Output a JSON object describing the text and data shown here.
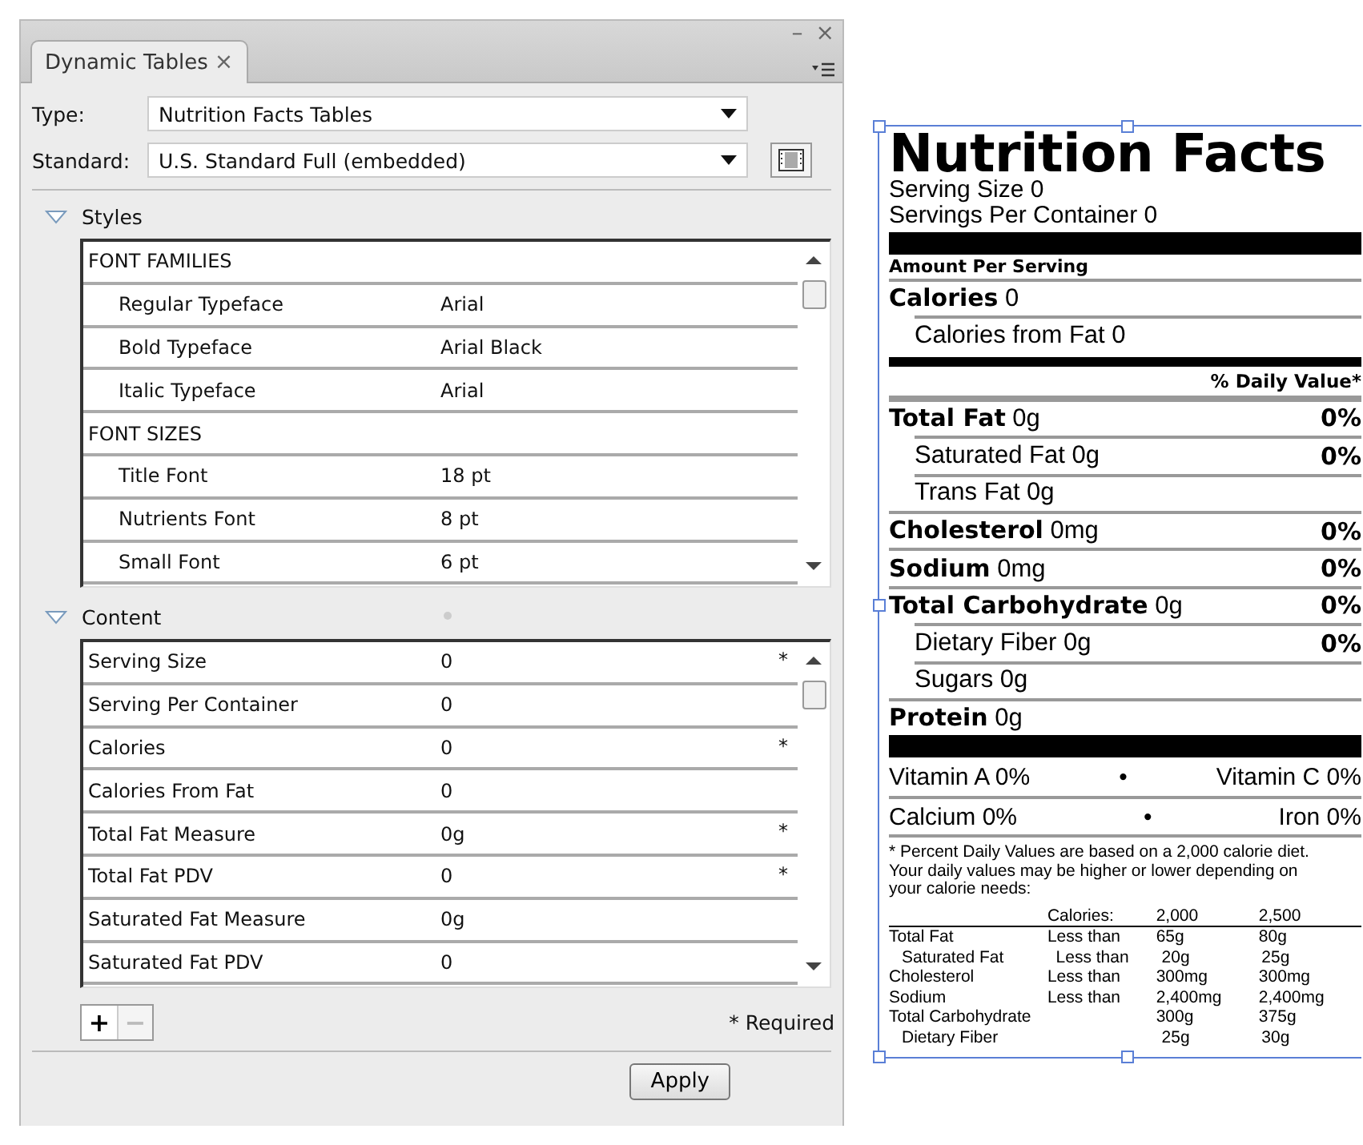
{
  "panel": {
    "tab": {
      "label": "Dynamic Tables",
      "close": "×",
      "selected": true
    },
    "window_controls": {
      "minimize": "–",
      "close": "×"
    },
    "type_field": {
      "label": "Type:",
      "value": "Nutrition Facts Tables"
    },
    "standard_field": {
      "label": "Standard:",
      "value": "U.S. Standard Full (embedded)"
    },
    "styles": {
      "title": "Styles",
      "expanded": true,
      "rows": [
        {
          "kind": "header",
          "label": "FONT FAMILIES"
        },
        {
          "kind": "item",
          "label": "Regular Typeface",
          "value": "Arial"
        },
        {
          "kind": "item",
          "label": "Bold Typeface",
          "value": "Arial Black"
        },
        {
          "kind": "item",
          "label": "Italic Typeface",
          "value": "Arial"
        },
        {
          "kind": "header",
          "label": "FONT SIZES"
        },
        {
          "kind": "item",
          "label": "Title Font",
          "value": "18 pt"
        },
        {
          "kind": "item",
          "label": "Nutrients Font",
          "value": "8 pt"
        },
        {
          "kind": "item",
          "label": "Small Font",
          "value": "6 pt"
        }
      ]
    },
    "content": {
      "title": "Content",
      "expanded": true,
      "rows": [
        {
          "label": "Serving Size",
          "value": "0",
          "required_mark": "*"
        },
        {
          "label": "Serving Per Container",
          "value": "0"
        },
        {
          "label": "Calories",
          "value": "0",
          "required_mark": "*"
        },
        {
          "label": "Calories From Fat",
          "value": "0"
        },
        {
          "label": "Total Fat Measure",
          "value": "0g",
          "required_mark": "*"
        },
        {
          "label": "Total Fat PDV",
          "value": "0",
          "required_mark": "*"
        },
        {
          "label": "Saturated Fat Measure",
          "value": "0g"
        },
        {
          "label": "Saturated Fat PDV",
          "value": "0"
        }
      ]
    },
    "add_button": "+",
    "remove_button": "−",
    "required_note": "* Required",
    "apply_button": "Apply"
  },
  "nutrition_label": {
    "title": "Nutrition Facts",
    "serving_size": "Serving Size 0",
    "servings_per_container": "Servings Per Container 0",
    "amount_per_serving": "Amount Per Serving",
    "calories": {
      "name": "Calories",
      "amount": "0"
    },
    "calories_from_fat": "Calories from Fat 0",
    "daily_value_heading": "% Daily Value*",
    "nutrients": [
      {
        "name": "Total Fat",
        "amount": "0g",
        "pdv": "0%",
        "children": [
          {
            "name": "Saturated Fat",
            "amount": "0g",
            "pdv": "0%"
          },
          {
            "name": "Trans Fat",
            "amount": "0g"
          }
        ]
      },
      {
        "name": "Cholesterol",
        "amount": "0mg",
        "pdv": "0%"
      },
      {
        "name": "Sodium",
        "amount": "0mg",
        "pdv": "0%"
      },
      {
        "name": "Total Carbohydrate",
        "amount": "0g",
        "pdv": "0%",
        "children": [
          {
            "name": "Dietary Fiber",
            "amount": "0g",
            "pdv": "0%"
          },
          {
            "name": "Sugars",
            "amount": "0g"
          }
        ]
      },
      {
        "name": "Protein",
        "amount": "0g"
      }
    ],
    "vitamins": [
      {
        "left": "Vitamin A 0%",
        "dot": "•",
        "right": "Vitamin C 0%"
      },
      {
        "left": "Calcium 0%",
        "dot": "•",
        "right": "Iron 0%"
      }
    ],
    "footnote": "* Percent Daily Values are based on a 2,000 calorie diet. Your daily values may be higher or lower depending on your calorie needs:",
    "footnote_table": {
      "header": {
        "label": "Calories:",
        "col1": "2,000",
        "col2": "2,500"
      },
      "rows": [
        {
          "name": "Total Fat",
          "limit": "Less than",
          "col1": "65g",
          "col2": "80g",
          "children": [
            {
              "name": "Saturated Fat",
              "limit": "Less than",
              "col1": "20g",
              "col2": "25g"
            }
          ]
        },
        {
          "name": "Cholesterol",
          "limit": "Less than",
          "col1": "300mg",
          "col2": "300mg"
        },
        {
          "name": "Sodium",
          "limit": "Less than",
          "col1": "2,400mg",
          "col2": "2,400mg"
        },
        {
          "name": "Total Carbohydrate",
          "col1": "300g",
          "col2": "375g",
          "children": [
            {
              "name": "Dietary Fiber",
              "col1": "25g",
              "col2": "30g"
            }
          ]
        }
      ]
    }
  }
}
